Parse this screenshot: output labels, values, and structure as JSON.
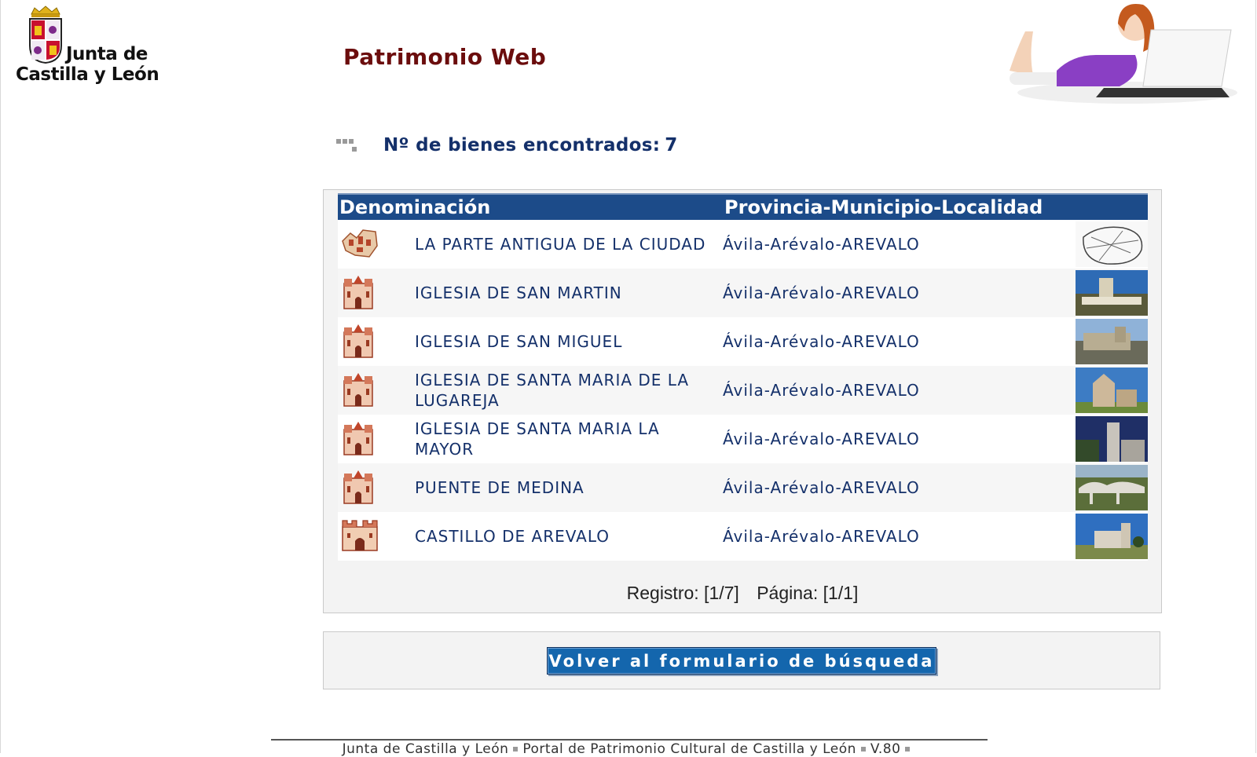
{
  "brand": {
    "line1": "Junta de",
    "line2": "Castilla y León"
  },
  "site_title": "Patrimonio Web",
  "results_count": {
    "label": "Nº de bienes encontrados:",
    "value": "7"
  },
  "table": {
    "headers": [
      "Denominación",
      "Provincia-Municipio-Localidad"
    ],
    "rows": [
      {
        "icon": "town-icon",
        "name": "LA PARTE ANTIGUA DE LA CIUDAD",
        "location": "Ávila-Arévalo-AREVALO",
        "thumb": "map-thumbnail"
      },
      {
        "icon": "church-icon",
        "name": "IGLESIA DE SAN MARTIN",
        "location": "Ávila-Arévalo-AREVALO",
        "thumb": "photo-thumbnail"
      },
      {
        "icon": "church-icon",
        "name": "IGLESIA DE SAN MIGUEL",
        "location": "Ávila-Arévalo-AREVALO",
        "thumb": "photo-thumbnail"
      },
      {
        "icon": "church-icon",
        "name": "IGLESIA DE SANTA MARIA DE LA LUGAREJA",
        "location": "Ávila-Arévalo-AREVALO",
        "thumb": "photo-thumbnail"
      },
      {
        "icon": "church-icon",
        "name": "IGLESIA DE SANTA MARIA LA MAYOR",
        "location": "Ávila-Arévalo-AREVALO",
        "thumb": "photo-thumbnail"
      },
      {
        "icon": "church-icon",
        "name": "PUENTE DE MEDINA",
        "location": "Ávila-Arévalo-AREVALO",
        "thumb": "photo-thumbnail"
      },
      {
        "icon": "castle-icon",
        "name": "CASTILLO DE AREVALO",
        "location": "Ávila-Arévalo-AREVALO",
        "thumb": "photo-thumbnail"
      }
    ]
  },
  "pager": {
    "registro": "Registro: [1/7]",
    "pagina": "Página: [1/1]"
  },
  "back_button": "Volver al formulario de búsqueda",
  "footer": {
    "items": [
      "Junta de Castilla y León",
      "Portal de Patrimonio Cultural de Castilla y León",
      "V.80"
    ]
  },
  "colors": {
    "header_bg": "#1c4b89",
    "title": "#6b0d0d",
    "link_text": "#14306a",
    "button_bg": "#1466ad"
  }
}
